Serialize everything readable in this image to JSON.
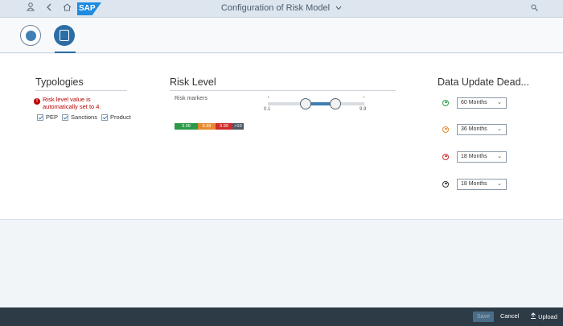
{
  "shell": {
    "title": "Configuration of Risk Model",
    "logo": "SAP",
    "icons": [
      "user-icon",
      "back-icon",
      "home-icon",
      "search-icon"
    ]
  },
  "tabs": [
    {
      "name": "tab-dashboard",
      "icon": "gauge-icon"
    },
    {
      "name": "tab-risk-model",
      "icon": "document-icon",
      "selected": true
    }
  ],
  "typologies": {
    "title": "Typologies",
    "warning": "Risk level value is automatically set to 4.",
    "checkboxes": [
      {
        "label": "PEP",
        "checked": true
      },
      {
        "label": "Sanctions",
        "checked": true
      },
      {
        "label": "Product",
        "checked": true
      }
    ]
  },
  "risk_level": {
    "title": "Risk Level",
    "markers_label": "Risk markers",
    "slider_min": "0.1",
    "slider_max": "9.9",
    "scale": [
      {
        "label": "3.99",
        "color": "#2c9a48"
      },
      {
        "label": "6.99",
        "color": "#e68a2e"
      },
      {
        "label": "9.99",
        "color": "#d12b2b"
      },
      {
        "label": ">10",
        "color": "#4d5a66"
      }
    ]
  },
  "data_update": {
    "title": "Data Update Dead...",
    "rows": [
      {
        "value": "60 Months",
        "icon_color": "#2c9a48"
      },
      {
        "value": "36 Months",
        "icon_color": "#e68a2e"
      },
      {
        "value": "18 Months",
        "icon_color": "#d12b2b"
      },
      {
        "value": "18 Months",
        "icon_color": "#333333"
      }
    ]
  },
  "footer": {
    "save": "Save",
    "cancel": "Cancel",
    "upload": "Upload"
  }
}
